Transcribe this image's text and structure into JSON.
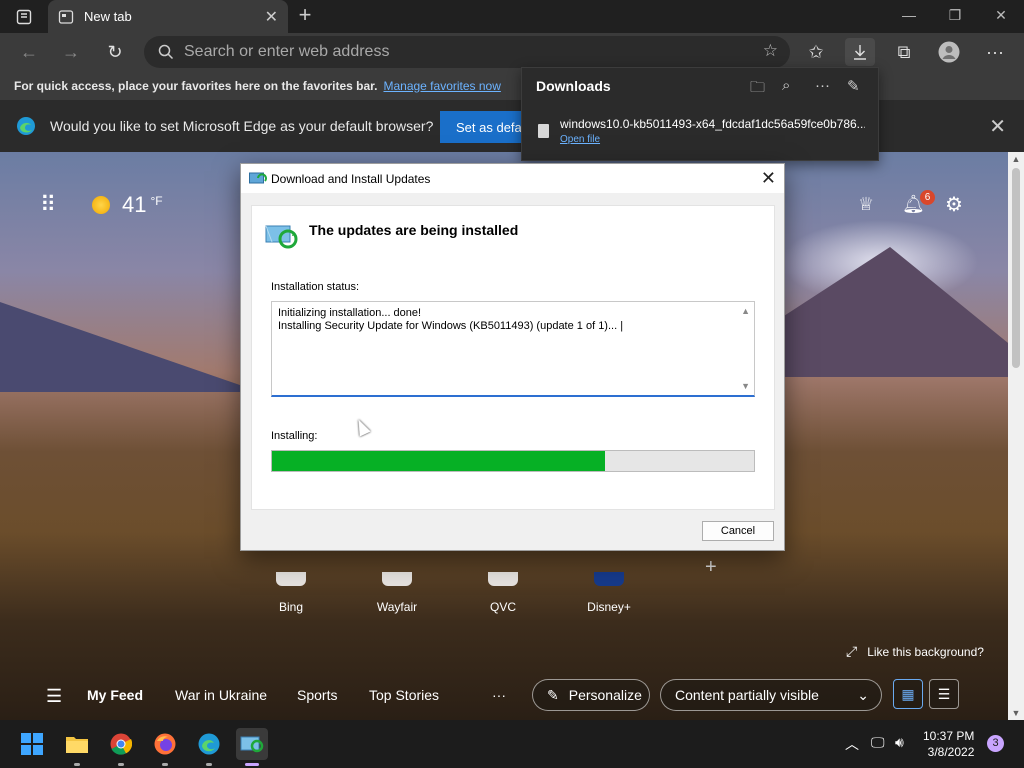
{
  "browser": {
    "tab_title": "New tab",
    "address_placeholder": "Search or enter web address",
    "favorites_bar": {
      "text": "For quick access, place your favorites here on the favorites bar.",
      "link": "Manage favorites now"
    },
    "infobar": {
      "message": "Would you like to set Microsoft Edge as your default browser?",
      "button": "Set as default"
    }
  },
  "downloads": {
    "title": "Downloads",
    "file_name": "windows10.0-kb5011493-x64_fdcdaf1dc56a59fce0b786...",
    "open_file": "Open file"
  },
  "newtab": {
    "temperature": "41",
    "temp_unit": "°F",
    "notification_count": "6",
    "quick_links": [
      {
        "label": "Bing"
      },
      {
        "label": "Wayfair"
      },
      {
        "label": "QVC"
      },
      {
        "label": "Disney+"
      }
    ],
    "like_background": "Like this background?",
    "feed": {
      "items": [
        "My Feed",
        "War in Ukraine",
        "Sports",
        "Top Stories"
      ],
      "more": "···",
      "personalize": "Personalize",
      "content_visibility": "Content partially visible"
    }
  },
  "dialog": {
    "title": "Download and Install Updates",
    "heading": "The updates are being installed",
    "status_label": "Installation status:",
    "status_lines": [
      "Initializing installation... done!",
      "Installing Security Update for Windows (KB5011493) (update 1 of 1)... |"
    ],
    "progress_label": "Installing:",
    "progress_fraction": 0.69,
    "cancel": "Cancel"
  },
  "taskbar": {
    "time": "10:37 PM",
    "date": "3/8/2022",
    "notification_count": "3"
  },
  "colors": {
    "progress": "#06b025",
    "accent": "#1a6fc9",
    "link": "#6cb3ff"
  }
}
